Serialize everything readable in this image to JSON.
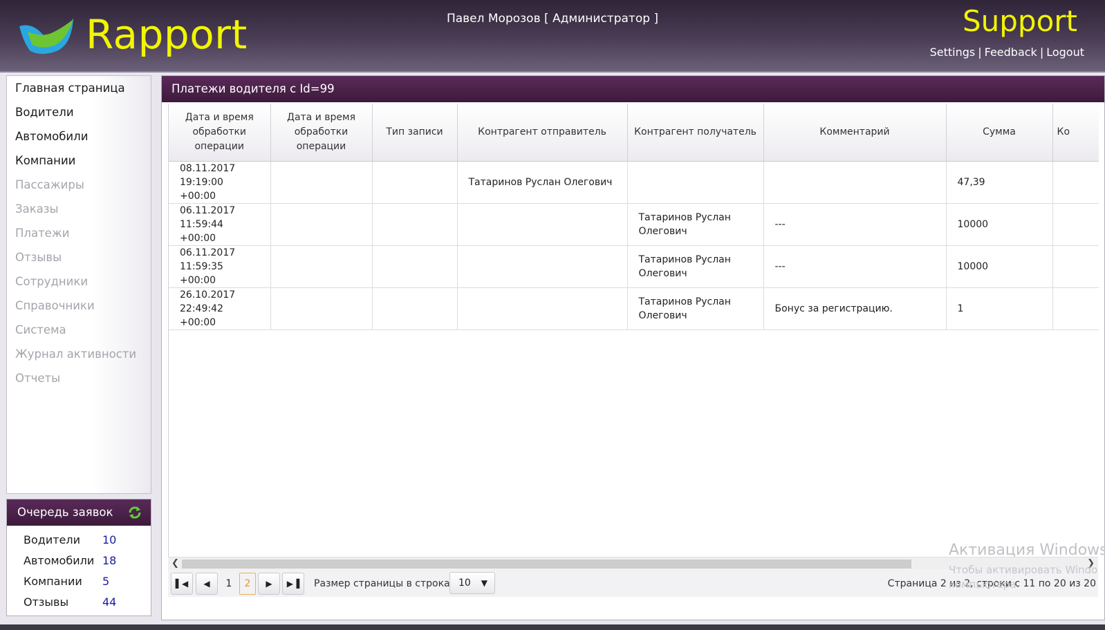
{
  "header": {
    "brand": "Rapport",
    "user": "Павел Морозов [ Администратор ]",
    "support": "Support",
    "links": [
      "Settings",
      "Feedback",
      "Logout"
    ],
    "separator": "|"
  },
  "nav": {
    "items": [
      {
        "label": "Главная страница",
        "enabled": true
      },
      {
        "label": "Водители",
        "enabled": true
      },
      {
        "label": "Автомобили",
        "enabled": true
      },
      {
        "label": "Компании",
        "enabled": true
      },
      {
        "label": "Пассажиры",
        "enabled": false
      },
      {
        "label": "Заказы",
        "enabled": false
      },
      {
        "label": "Платежи",
        "enabled": false
      },
      {
        "label": "Отзывы",
        "enabled": false
      },
      {
        "label": "Сотрудники",
        "enabled": false
      },
      {
        "label": "Справочники",
        "enabled": false
      },
      {
        "label": "Система",
        "enabled": false
      },
      {
        "label": "Журнал активности",
        "enabled": false
      },
      {
        "label": "Отчеты",
        "enabled": false
      }
    ]
  },
  "queue": {
    "title": "Очередь заявок",
    "rows": [
      {
        "label": "Водители",
        "value": "10"
      },
      {
        "label": "Автомобили",
        "value": "18"
      },
      {
        "label": "Компании",
        "value": "5"
      },
      {
        "label": "Отзывы",
        "value": "44"
      }
    ]
  },
  "main": {
    "title": "Платежи водителя с Id=99",
    "columns": [
      "Дата и время обработки операции",
      "Дата и время обработки операции",
      "Тип записи",
      "Контрагент отправитель",
      "Контрагент получатель",
      "Комментарий",
      "Сумма",
      "Ко"
    ],
    "rows": [
      [
        "08.11.2017 19:19:00 +00:00",
        "",
        "",
        "Татаринов Руслан Олегович",
        "",
        "",
        "47,39",
        ""
      ],
      [
        "06.11.2017 11:59:44 +00:00",
        "",
        "",
        "",
        "Татаринов Руслан Олегович",
        "---",
        "10000",
        ""
      ],
      [
        "06.11.2017 11:59:35 +00:00",
        "",
        "",
        "",
        "Татаринов Руслан Олегович",
        "---",
        "10000",
        ""
      ],
      [
        "26.10.2017 22:49:42 +00:00",
        "",
        "",
        "",
        "Татаринов Руслан Олегович",
        "Бонус за регистрацию.",
        "1",
        ""
      ]
    ]
  },
  "pager": {
    "pages": [
      "1",
      "2"
    ],
    "current_page": "2",
    "size_label": "Размер страницы в строках:",
    "size_value": "10",
    "info": "Страница 2 из 2, строки с 11 по 20 из 20"
  },
  "watermark": {
    "line1": "Активация Windows",
    "line2": "Чтобы активировать Windo",
    "line3": "компьютера."
  },
  "colors": {
    "brand_yellow": "#f2f500",
    "panel_header": "#4a2149",
    "pager_current": "#e09a2d"
  }
}
